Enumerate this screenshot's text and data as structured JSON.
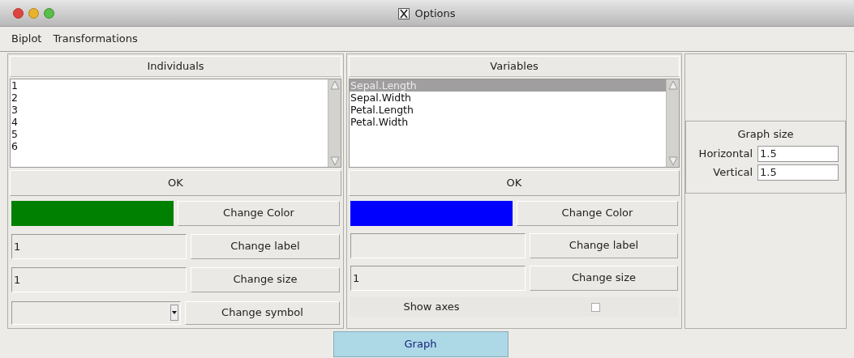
{
  "window": {
    "title": "Options"
  },
  "menu": [
    "Biplot",
    "Transformations"
  ],
  "individuals": {
    "header": "Individuals",
    "items": [
      {
        "label": "1",
        "selected": false
      },
      {
        "label": "2",
        "selected": false
      },
      {
        "label": "3",
        "selected": false
      },
      {
        "label": "4",
        "selected": false
      },
      {
        "label": "5",
        "selected": false
      },
      {
        "label": "6",
        "selected": false
      }
    ],
    "ok": "OK",
    "color": "#008000",
    "color_button": "Change Color",
    "label_value": "1",
    "label_button": "Change label",
    "size_value": "1",
    "size_button": "Change size",
    "symbol_button": "Change symbol"
  },
  "variables": {
    "header": "Variables",
    "items": [
      {
        "label": "Sepal.Length",
        "selected": true
      },
      {
        "label": "Sepal.Width",
        "selected": false
      },
      {
        "label": "Petal.Length",
        "selected": false
      },
      {
        "label": "Petal.Width",
        "selected": false
      }
    ],
    "ok": "OK",
    "color": "#0000ff",
    "color_button": "Change Color",
    "label_button": "Change label",
    "size_value": "1",
    "size_button": "Change size",
    "show_axes": {
      "label": "Show axes",
      "checked": false
    }
  },
  "graph_size": {
    "title": "Graph size",
    "fields": [
      {
        "label": "Horizontal",
        "value": "1.5"
      },
      {
        "label": "Vertical",
        "value": "1.5"
      }
    ]
  },
  "graph_button": "Graph"
}
